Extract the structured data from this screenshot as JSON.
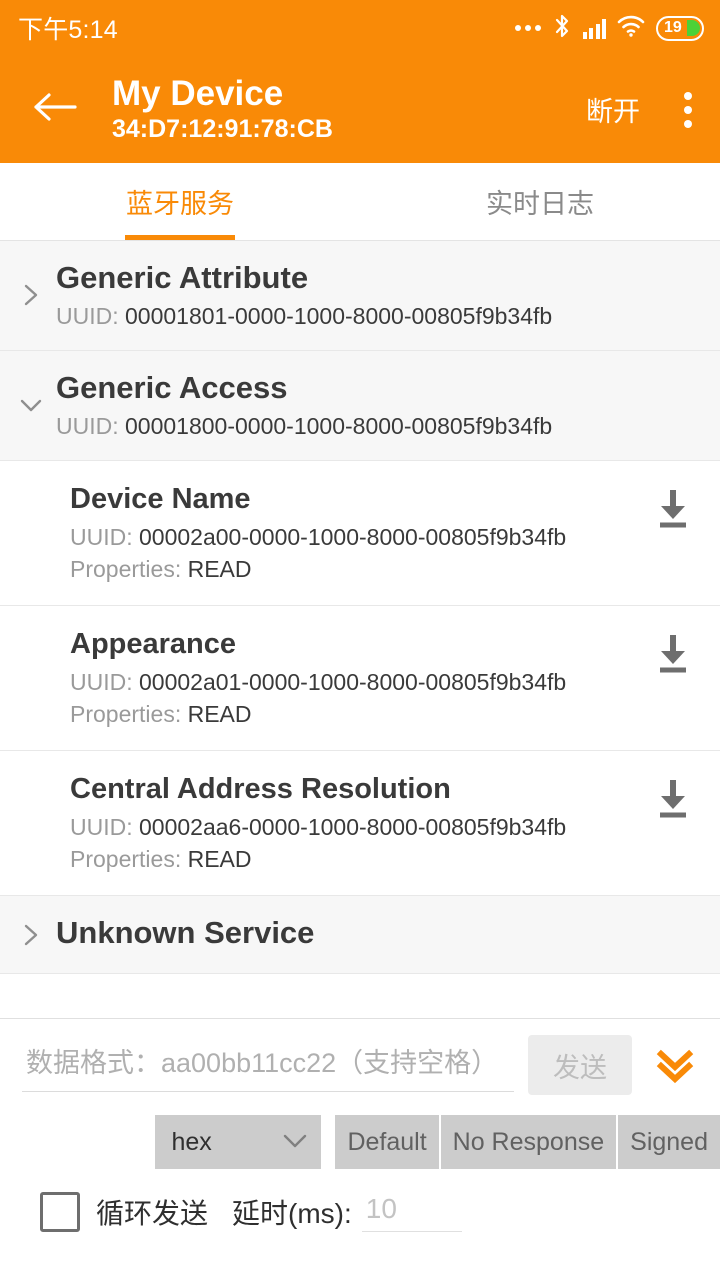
{
  "statusbar": {
    "time": "下午5:14",
    "icons": [
      "more-dots-icon",
      "bluetooth-icon",
      "cellular-signal-icon",
      "wifi-icon",
      "battery-icon"
    ],
    "battery_level": "19"
  },
  "appbar": {
    "back_icon": "back-arrow-icon",
    "title": "My Device",
    "subtitle": "34:D7:12:91:78:CB",
    "disconnect_label": "断开",
    "overflow_icon": "overflow-menu-icon",
    "background_color": "#F98A07"
  },
  "tabs": [
    {
      "label": "蓝牙服务",
      "active": true
    },
    {
      "label": "实时日志",
      "active": false
    }
  ],
  "services": [
    {
      "name": "Generic Attribute",
      "uuid_label": "UUID:",
      "uuid": "00001801-0000-1000-8000-00805f9b34fb",
      "expanded": false,
      "chevron": "chevron-right-icon"
    },
    {
      "name": "Generic Access",
      "uuid_label": "UUID:",
      "uuid": "00001800-0000-1000-8000-00805f9b34fb",
      "expanded": true,
      "chevron": "chevron-down-icon"
    },
    {
      "name": "Unknown Service",
      "uuid_label": "UUID:",
      "uuid": "",
      "expanded": false,
      "chevron": "chevron-right-icon"
    }
  ],
  "characteristics": [
    {
      "name": "Device Name",
      "uuid_label": "UUID:",
      "uuid": "00002a00-0000-1000-8000-00805f9b34fb",
      "props_label": "Properties:",
      "props": "READ",
      "action_icon": "download-read-icon"
    },
    {
      "name": "Appearance",
      "uuid_label": "UUID:",
      "uuid": "00002a01-0000-1000-8000-00805f9b34fb",
      "props_label": "Properties:",
      "props": "READ",
      "action_icon": "download-read-icon"
    },
    {
      "name": "Central Address Resolution",
      "uuid_label": "UUID:",
      "uuid": "00002aa6-0000-1000-8000-00805f9b34fb",
      "props_label": "Properties:",
      "props": "READ",
      "action_icon": "download-read-icon"
    }
  ],
  "bottom_panel": {
    "data_input": {
      "value": "",
      "placeholder": "数据格式：aa00bb11cc22（支持空格）"
    },
    "send_label": "发送",
    "send_enabled": false,
    "expand_icon": "double-chevron-down-icon",
    "format_select": {
      "value": "hex",
      "chevron": "chevron-down-icon"
    },
    "write_modes": [
      "Default",
      "No Response",
      "Signed"
    ],
    "loop_checkbox": {
      "checked": false,
      "label": "循环发送"
    },
    "delay": {
      "label": "延时(ms):",
      "value": "",
      "placeholder": "10"
    },
    "accent_color": "#F98A07"
  }
}
